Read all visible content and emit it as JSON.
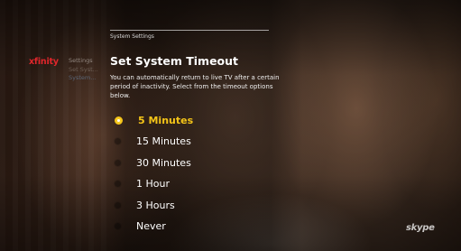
{
  "breadcrumb": "System Settings",
  "logo": "xfinity",
  "side_menu": [
    "Settings",
    "Set Syst...",
    "System..."
  ],
  "title": "Set System Timeout",
  "description": "You can automatically return to live TV after a certain period of inactivity. Select from the timeout options below.",
  "options": [
    {
      "label": "5 Minutes",
      "selected": true
    },
    {
      "label": "15 Minutes",
      "selected": false
    },
    {
      "label": "30 Minutes",
      "selected": false
    },
    {
      "label": "1 Hour",
      "selected": false
    },
    {
      "label": "3 Hours",
      "selected": false
    },
    {
      "label": "Never",
      "selected": false
    }
  ],
  "skype_label": "skype",
  "colors": {
    "accent": "#f5c518",
    "brand": "#e0262b"
  }
}
